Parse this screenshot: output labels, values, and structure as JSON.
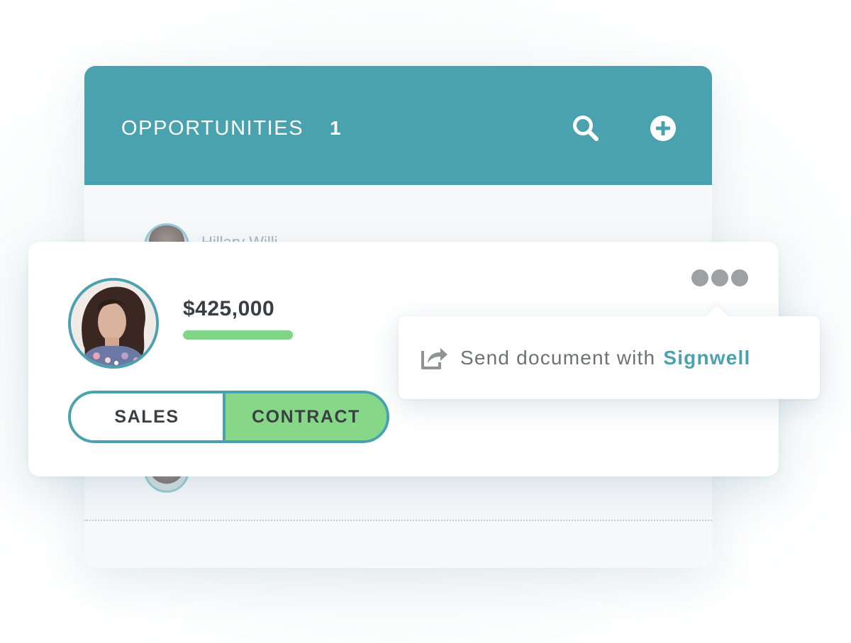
{
  "panel": {
    "title": "OPPORTUNITIES",
    "count": "1",
    "background_row_name": "Hillary Willi"
  },
  "card": {
    "amount": "$425,000",
    "progress_fraction": 0.98,
    "stages": [
      {
        "label": "SALES",
        "active": false
      },
      {
        "label": "CONTRACT",
        "active": true
      }
    ]
  },
  "menu": {
    "item_text": "Send document with",
    "item_brand": "Signwell"
  },
  "icons": {
    "search": "search-icon",
    "add": "plus-circle-icon",
    "more": "more-dots-icon",
    "share": "share-icon"
  },
  "colors": {
    "accent": "#4aa2af",
    "progress_green": "#7fd685",
    "contract_green": "#86d888",
    "menu_text": "#6d7275",
    "dots": "#9ea1a3"
  }
}
